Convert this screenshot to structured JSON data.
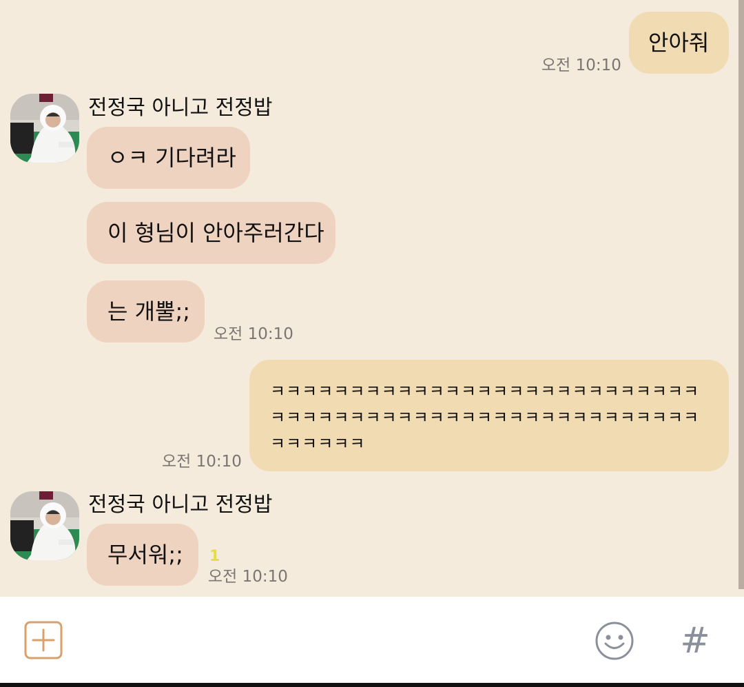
{
  "chat": {
    "messages": {
      "m1": {
        "text": "안아줘",
        "time": "오전 10:10"
      },
      "m2": {
        "sender": "전정국 아니고 전정밥",
        "text": "ㅇㅋ 기다려라"
      },
      "m3": {
        "text": "이 형님이 안아주러간다"
      },
      "m4": {
        "text": "는 개뿔;;",
        "time": "오전 10:10"
      },
      "m5": {
        "text": "ㅋㅋㅋㅋㅋㅋㅋㅋㅋㅋㅋㅋㅋㅋㅋㅋㅋㅋㅋㅋㅋㅋㅋㅋㅋㅋㅋㅋㅋㅋㅋㅋㅋㅋㅋㅋㅋㅋㅋㅋㅋㅋㅋㅋㅋㅋㅋㅋㅋㅋㅋㅋㅋㅋㅋㅋㅋㅋㅋㅋ",
        "time": "오전 10:10"
      },
      "m6": {
        "sender": "전정국 아니고 전정밥",
        "text": "무서워;;",
        "unread": "1",
        "time": "오전 10:10"
      }
    }
  },
  "input_bar": {
    "add_button": "plus-square-icon",
    "emoji_button": "smile-icon",
    "hashtag_label": "#"
  },
  "colors": {
    "chat_background": "#f5ebdd",
    "my_bubble": "#f1dbb3",
    "their_bubble": "#efd3c1",
    "unread_count": "#e6dd40",
    "add_icon": "#d8a06a"
  }
}
